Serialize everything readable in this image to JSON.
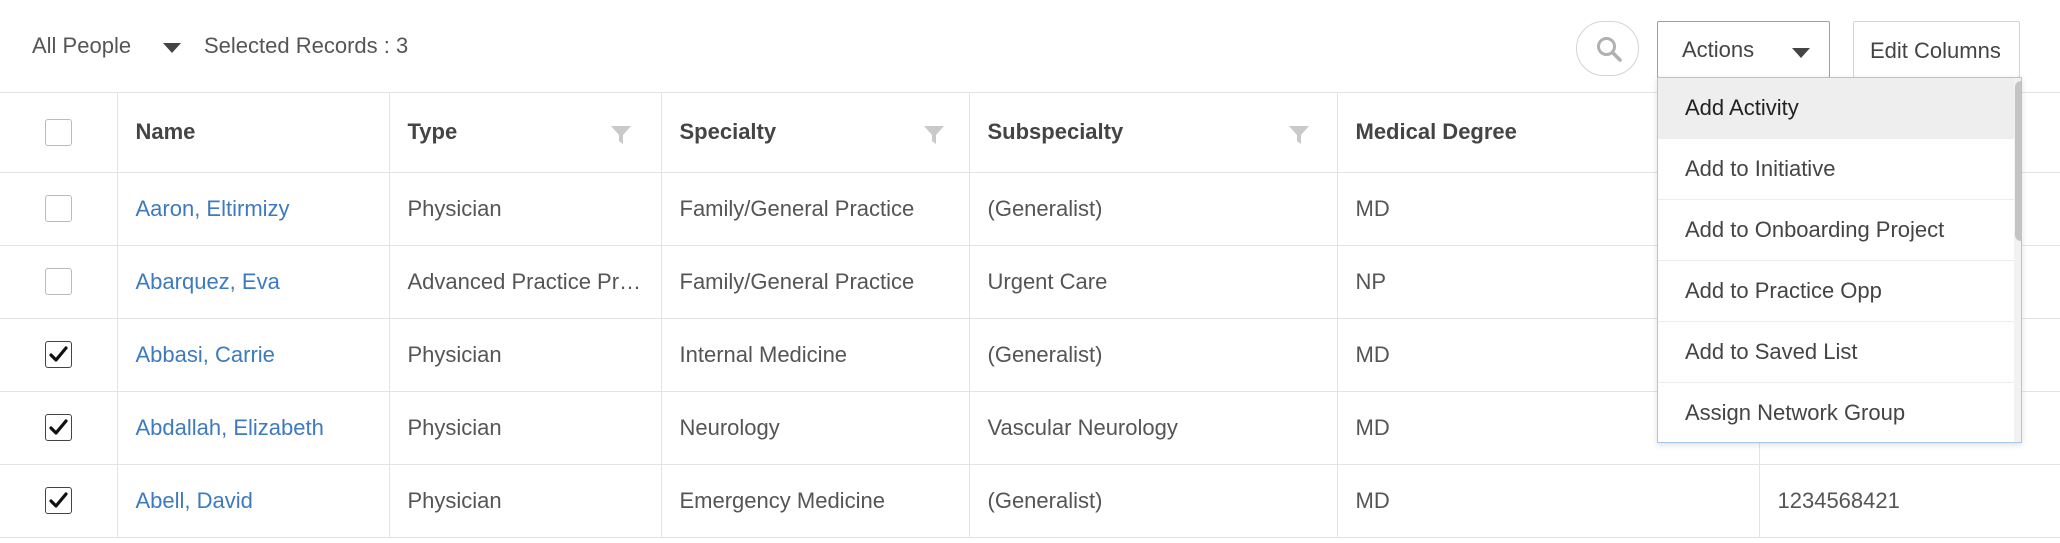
{
  "toolbar": {
    "view_label": "All People",
    "selected_records": "Selected Records : 3",
    "actions_label": "Actions",
    "edit_columns_label": "Edit Columns"
  },
  "table": {
    "columns": [
      "Name",
      "Type",
      "Specialty",
      "Subspecialty",
      "Medical Degree"
    ],
    "rows": [
      {
        "checked": false,
        "name": "Aaron, Eltirmizy",
        "type": "Physician",
        "specialty": "Family/General Practice",
        "subspecialty": "(Generalist)",
        "degree": "MD",
        "extra": ""
      },
      {
        "checked": false,
        "name": "Abarquez, Eva",
        "type": "Advanced Practice Pr…",
        "specialty": "Family/General Practice",
        "subspecialty": "Urgent Care",
        "degree": "NP",
        "extra": ""
      },
      {
        "checked": true,
        "name": "Abbasi, Carrie",
        "type": "Physician",
        "specialty": "Internal Medicine",
        "subspecialty": "(Generalist)",
        "degree": "MD",
        "extra": ""
      },
      {
        "checked": true,
        "name": "Abdallah, Elizabeth",
        "type": "Physician",
        "specialty": "Neurology",
        "subspecialty": "Vascular Neurology",
        "degree": "MD",
        "extra": ""
      },
      {
        "checked": true,
        "name": "Abell, David",
        "type": "Physician",
        "specialty": "Emergency Medicine",
        "subspecialty": "(Generalist)",
        "degree": "MD",
        "extra": "1234568421"
      }
    ]
  },
  "actions_menu": {
    "items": [
      {
        "label": "Add Activity",
        "hover": true
      },
      {
        "label": "Add to Initiative",
        "hover": false
      },
      {
        "label": "Add to Onboarding Project",
        "hover": false
      },
      {
        "label": "Add to Practice Opp",
        "hover": false
      },
      {
        "label": "Add to Saved List",
        "hover": false
      },
      {
        "label": "Assign Network Group",
        "hover": false
      }
    ]
  },
  "icons": {
    "search": "search-icon",
    "caret": "chevron-down-icon",
    "filter": "filter-funnel-icon",
    "check": "checkmark-icon"
  },
  "colors": {
    "link": "#3d7ac0",
    "accent_border": "#7aa7d6",
    "hover_bg": "#eeeeee"
  }
}
